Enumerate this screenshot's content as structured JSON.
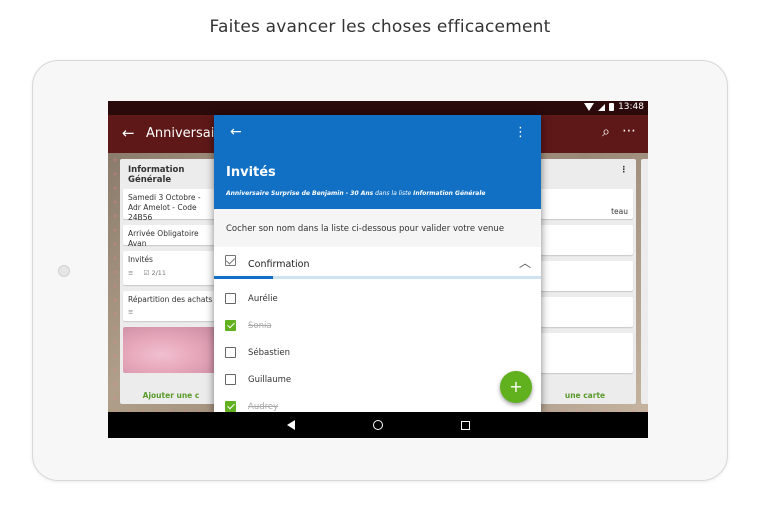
{
  "headline": "Faites avancer les choses efficacement",
  "status_bar": {
    "time": "13:48"
  },
  "background_board": {
    "title": "Anniversaire S",
    "left_list": {
      "header": "Information Générale",
      "cards": [
        "Samedi 3 Octobre - Adr Amelot - Code 24B56",
        "Arrivée Obligatoire Avan",
        "Invités",
        "2/11",
        "Répartition des achats"
      ],
      "add_card": "Ajouter une c"
    },
    "right_list": {
      "cards": [
        "teau"
      ],
      "add_card": "une carte"
    }
  },
  "panel": {
    "title": "Invités",
    "subtitle_board": "Anniversaire Surprise de Benjamin - 30 Ans",
    "subtitle_mid": " dans la liste ",
    "subtitle_list": "Information Générale",
    "description": "Cocher son nom dans la liste ci-dessous pour valider votre venue",
    "checklist": {
      "title": "Confirmation",
      "progress": 0.18,
      "items": [
        {
          "label": "Aurélie",
          "checked": false
        },
        {
          "label": "Sonia",
          "checked": true
        },
        {
          "label": "Sébastien",
          "checked": false
        },
        {
          "label": "Guillaume",
          "checked": false
        },
        {
          "label": "Audrey",
          "checked": true
        }
      ]
    },
    "fab_label": "+"
  },
  "colors": {
    "header_blue": "#1170c4",
    "check_green": "#61b01e",
    "toolbar_maroon": "#5e1818"
  }
}
